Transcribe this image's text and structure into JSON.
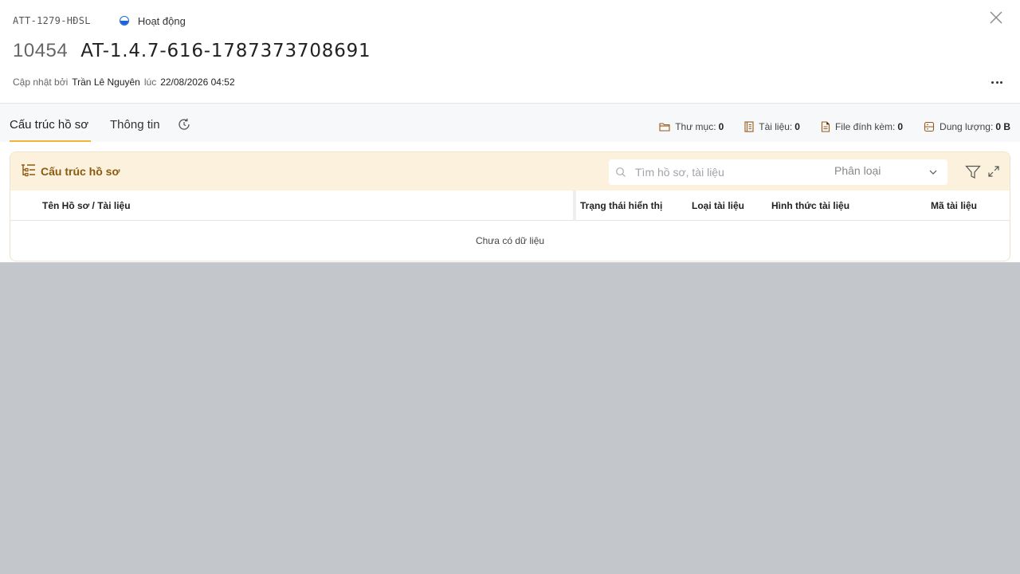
{
  "header": {
    "code": "ATT-1279-HĐSL",
    "status": "Hoạt động",
    "doc_number": "10454",
    "doc_name": "AT-1.4.7-616-1787373708691",
    "updated_by_label": "Cập nhật bởi",
    "updated_by": "Trần Lê Nguyên",
    "at_label": "lúc",
    "updated_at": "22/08/2026 04:52"
  },
  "tabs": [
    {
      "label": "Cấu trúc hồ sơ",
      "active": true
    },
    {
      "label": "Thông tin",
      "active": false
    }
  ],
  "stats": {
    "folders_label": "Thư mục:",
    "folders": "0",
    "docs_label": "Tài liệu:",
    "docs": "0",
    "files_label": "File đính kèm:",
    "files": "0",
    "size_label": "Dung lượng:",
    "size": "0 B"
  },
  "structure": {
    "title": "Cấu trúc hồ sơ",
    "search_placeholder": "Tìm hồ sơ, tài liệu",
    "classify_placeholder": "Phân loại",
    "columns": [
      "Tên Hồ sơ / Tài liệu",
      "Trạng thái hiển thị",
      "Loại tài liệu",
      "Hình thức tài liệu",
      "Mã tài liệu"
    ],
    "empty_text": "Chưa có dữ liệu"
  },
  "colors": {
    "accent": "#f0b43a",
    "card_header_bg": "#fbf1dc",
    "card_title": "#8a5a11",
    "status_blue": "#1a64d6",
    "overlay": "#c3c6cb"
  }
}
